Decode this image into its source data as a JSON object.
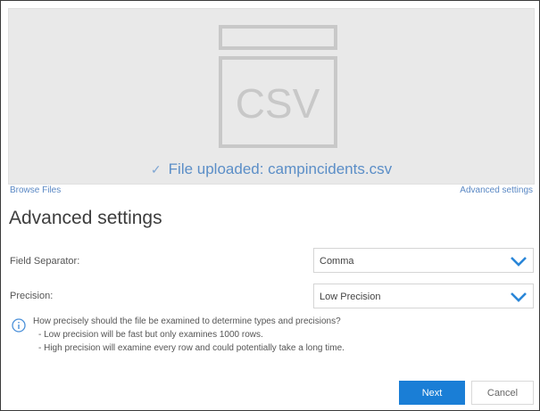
{
  "dropzone": {
    "icon_text": "CSV",
    "status_icon": "check-icon",
    "status_text": "File uploaded: campincidents.csv"
  },
  "links": {
    "browse": "Browse Files",
    "advanced": "Advanced settings"
  },
  "settings": {
    "title": "Advanced settings",
    "separator_label": "Field Separator:",
    "separator_value": "Comma",
    "precision_label": "Precision:",
    "precision_value": "Low Precision",
    "info_icon": "info-icon",
    "info_question": "How precisely should the file be examined to determine types and precisions?",
    "info_low": "- Low precision will be fast but only examines 1000 rows.",
    "info_high": "- High precision will examine every row and could potentially take a long time."
  },
  "buttons": {
    "next": "Next",
    "cancel": "Cancel"
  },
  "colors": {
    "primary": "#1a7ed6",
    "link": "#5a88c4",
    "chevron": "#2a86d8"
  }
}
